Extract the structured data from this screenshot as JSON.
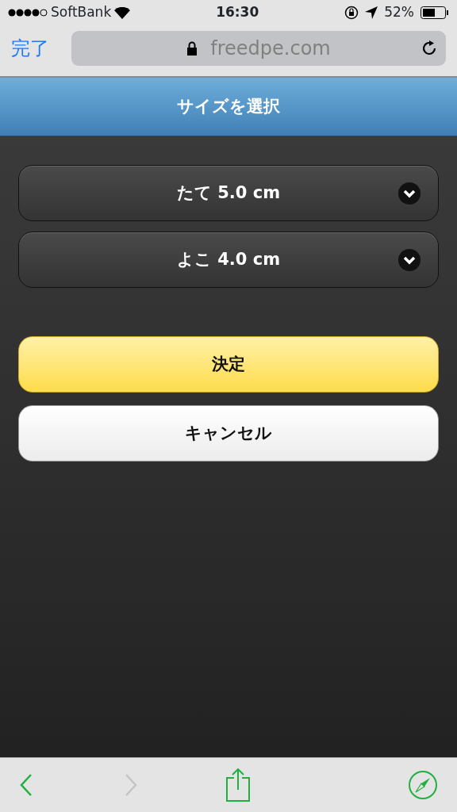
{
  "status_bar": {
    "carrier": "SoftBank",
    "time": "16:30",
    "battery": "52%"
  },
  "browser": {
    "done": "完了",
    "url": "freedpe.com"
  },
  "header": {
    "title": "サイズを選択"
  },
  "selects": [
    {
      "value": "たて 5.0 cm"
    },
    {
      "value": "よこ 4.0 cm"
    }
  ],
  "buttons": [
    {
      "label": "決定",
      "kind": "primary"
    },
    {
      "label": "キャンセル",
      "kind": "secondary"
    }
  ],
  "toolbar": {
    "back_disabled": false,
    "forward_disabled": true
  }
}
